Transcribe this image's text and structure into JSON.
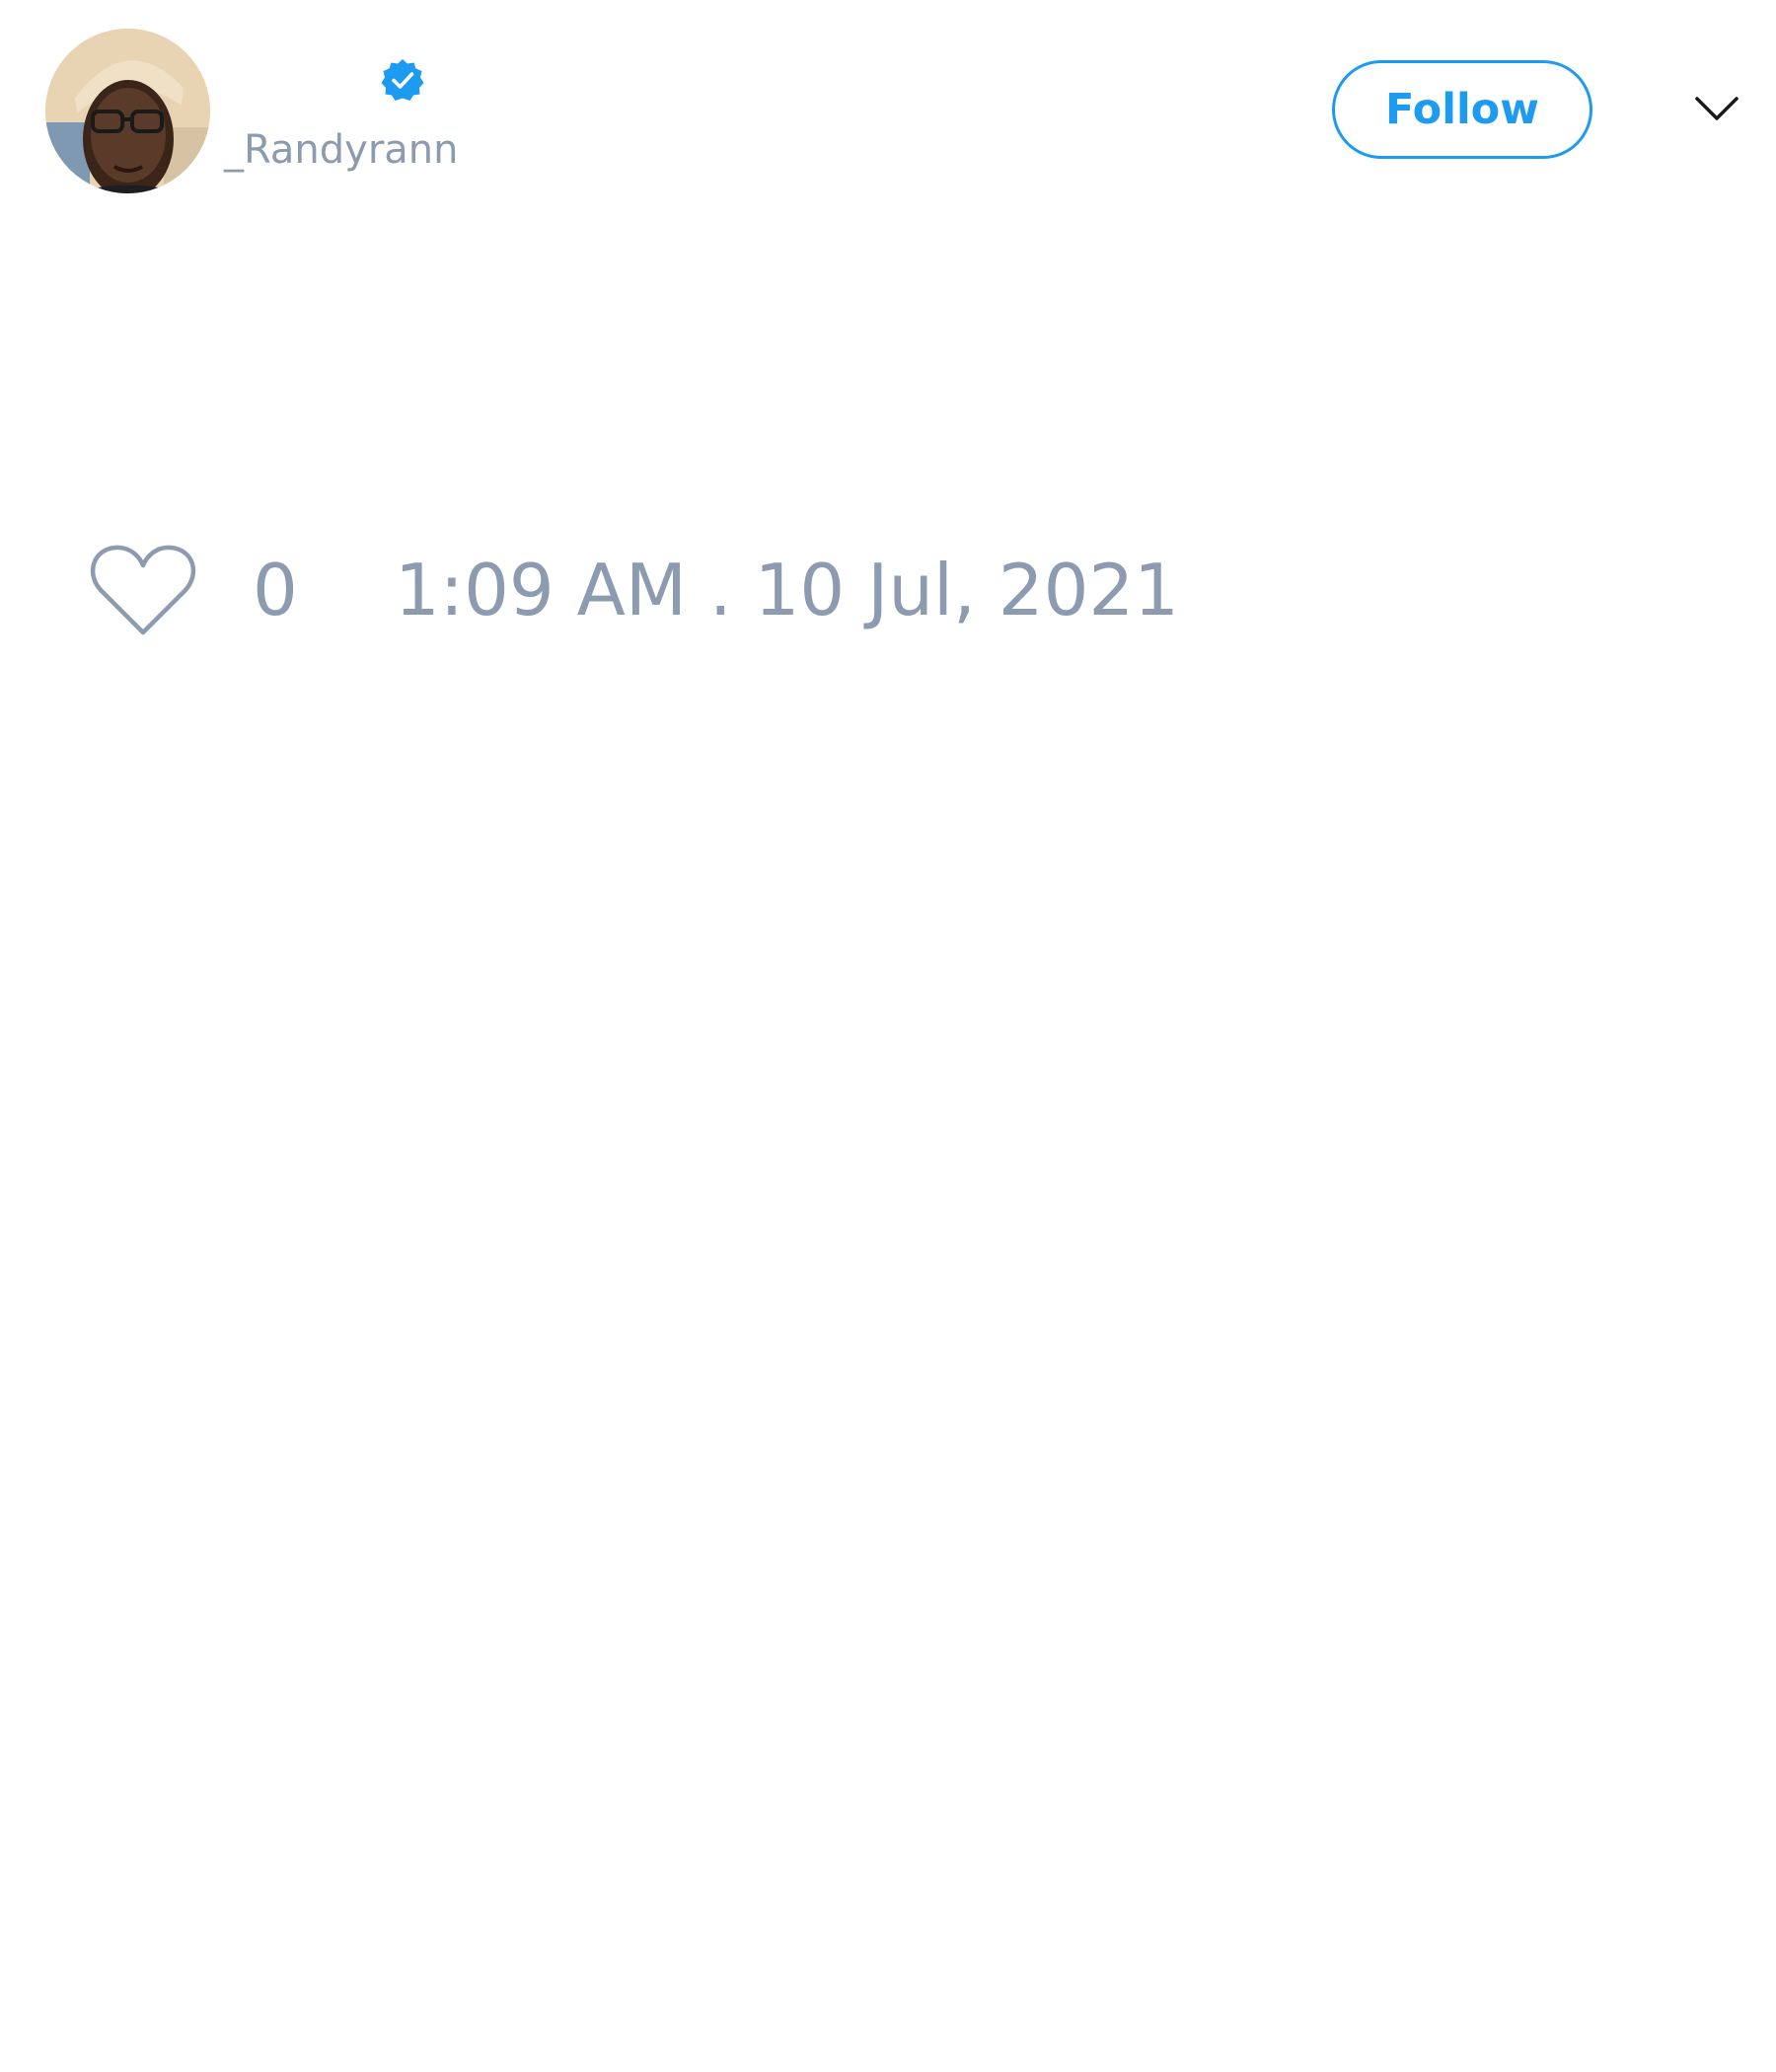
{
  "tweet": {
    "author": {
      "handle": "_Randyrann",
      "verified": true,
      "avatar_icon": "avatar-photo"
    },
    "follow_label": "Follow",
    "menu_icon": "chevron-down-icon",
    "likes": {
      "icon": "heart-outline-icon",
      "count": "0"
    },
    "timestamp": "1:09 AM . 10 Jul, 2021"
  },
  "colors": {
    "accent": "#1d9bf0",
    "muted_text": "#8d9bb0",
    "background": "#ffffff"
  }
}
